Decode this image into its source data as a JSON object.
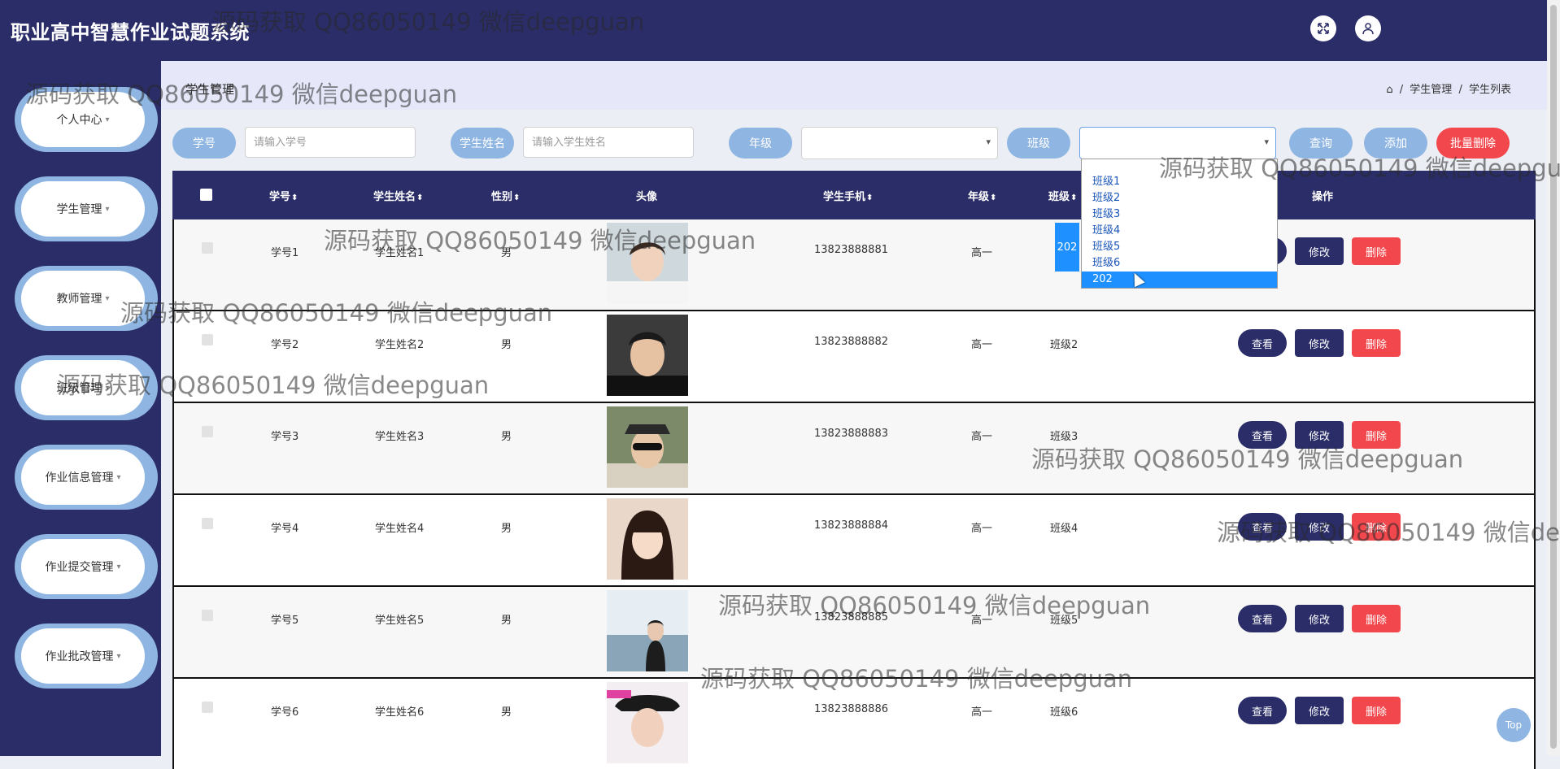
{
  "app": {
    "title": "职业高中智慧作业试题系统"
  },
  "header": {
    "fullscreen_icon": "expand-arrows-icon",
    "user_icon": "user-icon"
  },
  "sidebar": {
    "items": [
      {
        "label": "个人中心"
      },
      {
        "label": "学生管理"
      },
      {
        "label": "教师管理"
      },
      {
        "label": "班级管理"
      },
      {
        "label": "作业信息管理"
      },
      {
        "label": "作业提交管理"
      },
      {
        "label": "作业批改管理"
      }
    ]
  },
  "breadcrumb": {
    "heading": "学生管理",
    "home_icon": "home-icon",
    "level1": "学生管理",
    "level2": "学生列表",
    "sep": "/"
  },
  "filters": {
    "student_no_label": "学号",
    "student_no_placeholder": "请输入学号",
    "name_label": "学生姓名",
    "name_placeholder": "请输入学生姓名",
    "grade_label": "年级",
    "grade_value": "",
    "class_label": "班级",
    "class_value": "",
    "query_button": "查询",
    "add_button": "添加",
    "batch_delete_button": "批量删除"
  },
  "table": {
    "columns": [
      "学号",
      "学生姓名",
      "性别",
      "头像",
      "学生手机",
      "年级",
      "班级",
      "操作"
    ],
    "rows": [
      {
        "no": "学号1",
        "name": "学生姓名1",
        "gender": "男",
        "phone": "13823888881",
        "grade": "高一",
        "class": "202"
      },
      {
        "no": "学号2",
        "name": "学生姓名2",
        "gender": "男",
        "phone": "13823888882",
        "grade": "高一",
        "class": "班级2"
      },
      {
        "no": "学号3",
        "name": "学生姓名3",
        "gender": "男",
        "phone": "13823888883",
        "grade": "高一",
        "class": "班级3"
      },
      {
        "no": "学号4",
        "name": "学生姓名4",
        "gender": "男",
        "phone": "13823888884",
        "grade": "高一",
        "class": "班级4"
      },
      {
        "no": "学号5",
        "name": "学生姓名5",
        "gender": "男",
        "phone": "13823888885",
        "grade": "高一",
        "class": "班级5"
      },
      {
        "no": "学号6",
        "name": "学生姓名6",
        "gender": "男",
        "phone": "13823888886",
        "grade": "高一",
        "class": "班级6"
      }
    ],
    "actions": {
      "view": "查看",
      "edit": "修改",
      "delete": "删除"
    }
  },
  "class_dropdown": {
    "options": [
      "班级1",
      "班级2",
      "班级3",
      "班级4",
      "班级5",
      "班级6",
      "202"
    ],
    "highlighted": "202"
  },
  "top_button": "Top",
  "watermark": "源码获取 QQ86050149 微信deepguan",
  "colors": {
    "navy": "#2b2d69",
    "pill_blue": "#8fb5e2",
    "danger": "#f2484d",
    "highlight": "#1e90ff"
  }
}
